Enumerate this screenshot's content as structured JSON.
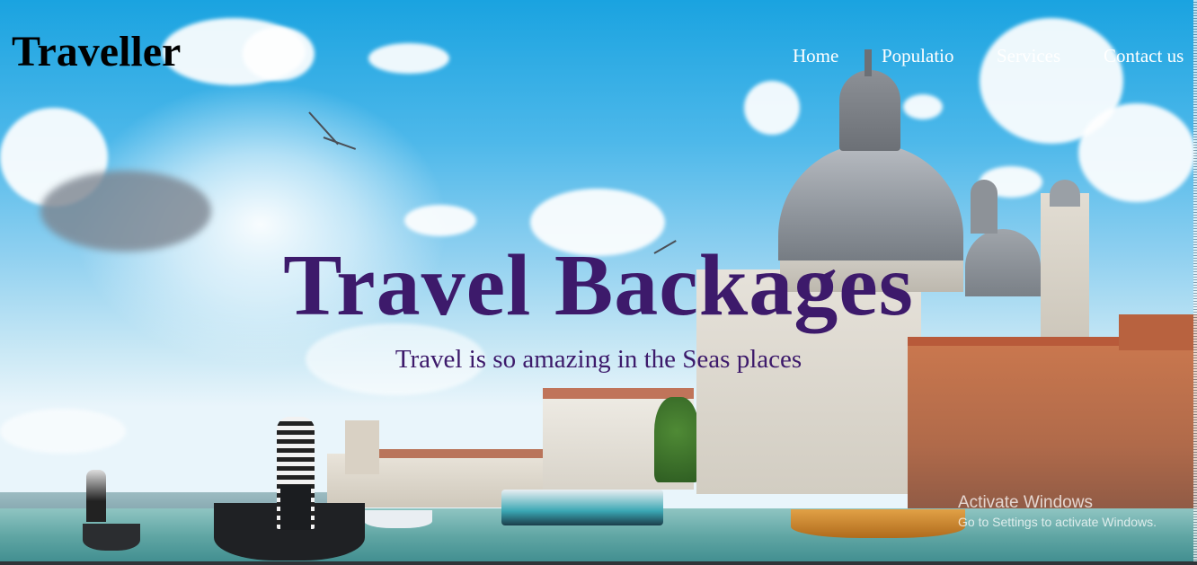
{
  "header": {
    "logo": "Traveller",
    "nav": [
      {
        "label": "Home"
      },
      {
        "label": "Populatio"
      },
      {
        "label": "Services"
      },
      {
        "label": "Contact us"
      }
    ]
  },
  "hero": {
    "title": "Travel Backages",
    "subtitle": "Travel is so amazing in the Seas places"
  },
  "watermark": {
    "line1": "Activate Windows",
    "line2": "Go to Settings to activate Windows."
  },
  "colors": {
    "title": "#3d1a6b",
    "nav_text": "#ffffff",
    "logo": "#000000",
    "sky": "#1aa3e0"
  }
}
